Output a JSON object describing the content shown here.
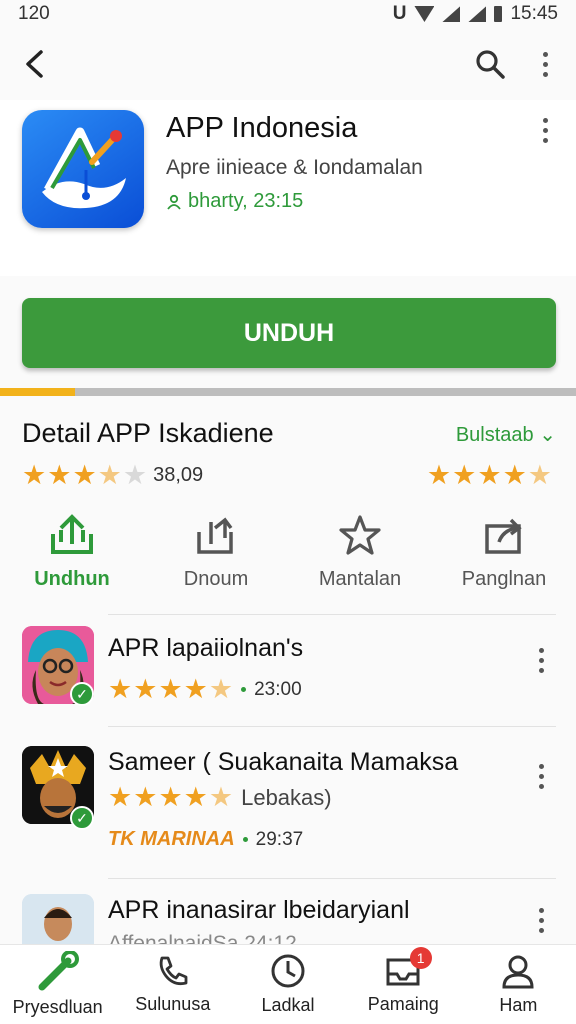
{
  "status_bar": {
    "time": "120",
    "clock": "15:45"
  },
  "app": {
    "title": "APP Indonesia",
    "subtitle": "Apre iinieace & Iondamalan",
    "meta": "bharty, 23:15",
    "install_label": "UNDUH",
    "download_progress": 0.13
  },
  "detail": {
    "title": "Detail APP Iskadiene",
    "link_label": "Bulstaab",
    "rating_count": "38,09",
    "rating_left": 3.5,
    "rating_right": 4.5
  },
  "actions": [
    {
      "label": "Undhun",
      "icon": "upload-icon"
    },
    {
      "label": "Dnoum",
      "icon": "share-icon"
    },
    {
      "label": "Mantalan",
      "icon": "star-icon"
    },
    {
      "label": "Panglnan",
      "icon": "forward-icon"
    }
  ],
  "list": [
    {
      "title": "APR lapaiiolnan's",
      "rating": 4.5,
      "time": "23:00",
      "tag": ""
    },
    {
      "title": "Sameer ( Suakanaita Mamaksa",
      "rating": 4.5,
      "time": "29:37",
      "extra": "Lebakas)",
      "tag": "TK MARINAA"
    },
    {
      "title": "APR inanasirar lbeidaryianl",
      "sub": "AffenalnaidSa 24:12"
    }
  ],
  "bottom_nav": [
    {
      "label": "Pryesdluan",
      "icon": "wrench-icon"
    },
    {
      "label": "Sulunusa",
      "icon": "phone-icon"
    },
    {
      "label": "Ladkal",
      "icon": "clock-icon"
    },
    {
      "label": "Pamaing",
      "icon": "inbox-icon",
      "badge": "1"
    },
    {
      "label": "Ham",
      "icon": "person-icon"
    }
  ],
  "colors": {
    "accent": "#3c9a3c",
    "star": "#f0a020",
    "progress": "#f2b21b",
    "badge": "#e53935"
  }
}
